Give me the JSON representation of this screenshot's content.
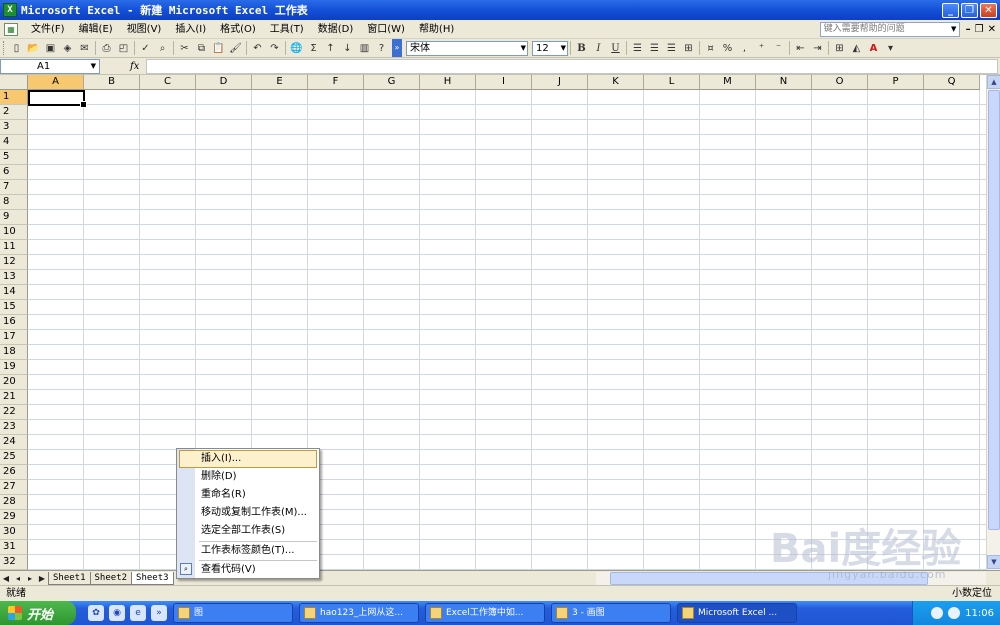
{
  "window": {
    "title": "Microsoft Excel - 新建 Microsoft Excel 工作表",
    "app_icon": "X"
  },
  "menu": {
    "items": [
      "文件(F)",
      "编辑(E)",
      "视图(V)",
      "插入(I)",
      "格式(O)",
      "工具(T)",
      "数据(D)",
      "窗口(W)",
      "帮助(H)"
    ],
    "help_placeholder": "键入需要帮助的问题"
  },
  "toolbar": {
    "font_name": "宋体",
    "font_size": "12",
    "bold": "B",
    "italic": "I",
    "underline": "U",
    "sigma": "Σ",
    "percent": "%",
    "comma": ","
  },
  "formula_bar": {
    "name_box": "A1",
    "fx": "fx",
    "content": ""
  },
  "grid": {
    "columns": [
      "A",
      "B",
      "C",
      "D",
      "E",
      "F",
      "G",
      "H",
      "I",
      "J",
      "K",
      "L",
      "M",
      "N",
      "O",
      "P",
      "Q"
    ],
    "rows": [
      "1",
      "2",
      "3",
      "4",
      "5",
      "6",
      "7",
      "8",
      "9",
      "10",
      "11",
      "12",
      "13",
      "14",
      "15",
      "16",
      "17",
      "18",
      "19",
      "20",
      "21",
      "22",
      "23",
      "24",
      "25",
      "26",
      "27",
      "28",
      "29",
      "30",
      "31",
      "32"
    ],
    "active_cell": "A1"
  },
  "sheets": {
    "tabs": [
      "Sheet1",
      "Sheet2",
      "Sheet3"
    ],
    "active": "Sheet3"
  },
  "context_menu": {
    "items": [
      {
        "label": "插入(I)...",
        "highlighted": true
      },
      {
        "label": "删除(D)"
      },
      {
        "label": "重命名(R)"
      },
      {
        "label": "移动或复制工作表(M)..."
      },
      {
        "label": "选定全部工作表(S)"
      },
      {
        "label": "工作表标签颜色(T)..."
      },
      {
        "label": "查看代码(V)"
      }
    ]
  },
  "status": {
    "left": "就绪",
    "right": "小数定位"
  },
  "taskbar": {
    "start_label": "开始",
    "tasks": [
      {
        "label": "图"
      },
      {
        "label": "hao123_上网从这..."
      },
      {
        "label": "Excel工作簿中如..."
      },
      {
        "label": "3 - 画图"
      },
      {
        "label": "Microsoft Excel ..."
      }
    ],
    "clock": "11:06"
  },
  "watermark": {
    "brand": "Bai度经验",
    "url": "jingyan.baidu.com"
  },
  "colors": {
    "titlebar": "#1450d8",
    "chrome": "#ece9d8",
    "header_active": "#f7c870",
    "gridline": "#d0d7e5",
    "menu_highlight": "#fcf0cd"
  }
}
